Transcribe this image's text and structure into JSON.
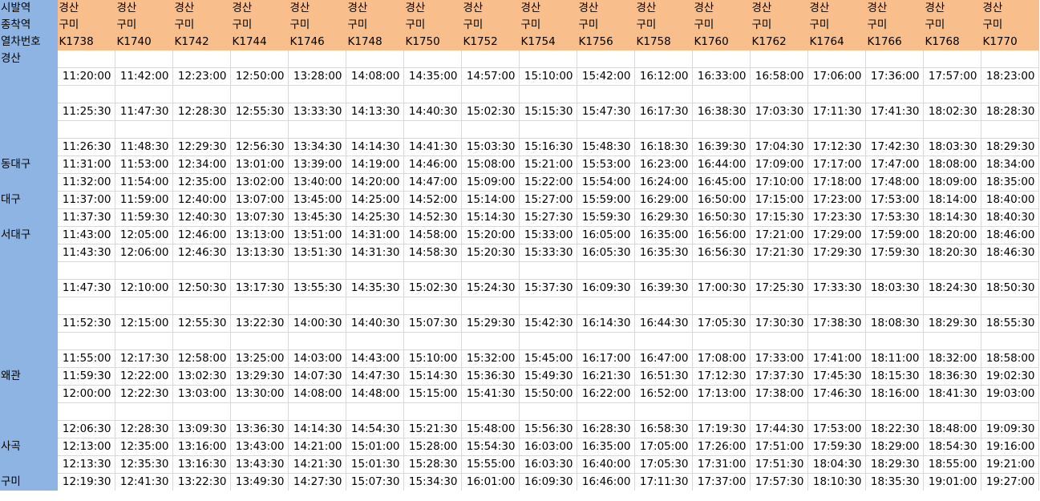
{
  "header": {
    "labels": [
      "시발역",
      "종착역",
      "열차번호"
    ],
    "origin": [
      "경산",
      "경산",
      "경산",
      "경산",
      "경산",
      "경산",
      "경산",
      "경산",
      "경산",
      "경산",
      "경산",
      "경산",
      "경산",
      "경산",
      "경산",
      "경산",
      "경산"
    ],
    "destination": [
      "구미",
      "구미",
      "구미",
      "구미",
      "구미",
      "구미",
      "구미",
      "구미",
      "구미",
      "구미",
      "구미",
      "구미",
      "구미",
      "구미",
      "구미",
      "구미",
      "구미"
    ],
    "trains": [
      "K1738",
      "K1740",
      "K1742",
      "K1744",
      "K1746",
      "K1748",
      "K1750",
      "K1752",
      "K1754",
      "K1756",
      "K1758",
      "K1760",
      "K1762",
      "K1764",
      "K1766",
      "K1768",
      "K1770"
    ]
  },
  "colors": {
    "header_bg": "#f8bf8d",
    "station_bg": "#8db4e2",
    "grid": "#d9d9d9"
  },
  "rows": [
    {
      "station": "경산",
      "times": []
    },
    {
      "station": "",
      "times": [
        "11:20:00",
        "11:42:00",
        "12:23:00",
        "12:50:00",
        "13:28:00",
        "14:08:00",
        "14:35:00",
        "14:57:00",
        "15:10:00",
        "15:42:00",
        "16:12:00",
        "16:33:00",
        "16:58:00",
        "17:06:00",
        "17:36:00",
        "17:57:00",
        "18:23:00"
      ]
    },
    {
      "station": "",
      "times": []
    },
    {
      "station": "",
      "times": [
        "11:25:30",
        "11:47:30",
        "12:28:30",
        "12:55:30",
        "13:33:30",
        "14:13:30",
        "14:40:30",
        "15:02:30",
        "15:15:30",
        "15:47:30",
        "16:17:30",
        "16:38:30",
        "17:03:30",
        "17:11:30",
        "17:41:30",
        "18:02:30",
        "18:28:30"
      ]
    },
    {
      "station": "",
      "times": []
    },
    {
      "station": "",
      "times": [
        "11:26:30",
        "11:48:30",
        "12:29:30",
        "12:56:30",
        "13:34:30",
        "14:14:30",
        "14:41:30",
        "15:03:30",
        "15:16:30",
        "15:48:30",
        "16:18:30",
        "16:39:30",
        "17:04:30",
        "17:12:30",
        "17:42:30",
        "18:03:30",
        "18:29:30"
      ]
    },
    {
      "station": "동대구",
      "times": [
        "11:31:00",
        "11:53:00",
        "12:34:00",
        "13:01:00",
        "13:39:00",
        "14:19:00",
        "14:46:00",
        "15:08:00",
        "15:21:00",
        "15:53:00",
        "16:23:00",
        "16:44:00",
        "17:09:00",
        "17:17:00",
        "17:47:00",
        "18:08:00",
        "18:34:00"
      ]
    },
    {
      "station": "",
      "times": [
        "11:32:00",
        "11:54:00",
        "12:35:00",
        "13:02:00",
        "13:40:00",
        "14:20:00",
        "14:47:00",
        "15:09:00",
        "15:22:00",
        "15:54:00",
        "16:24:00",
        "16:45:00",
        "17:10:00",
        "17:18:00",
        "17:48:00",
        "18:09:00",
        "18:35:00"
      ]
    },
    {
      "station": "대구",
      "times": [
        "11:37:00",
        "11:59:00",
        "12:40:00",
        "13:07:00",
        "13:45:00",
        "14:25:00",
        "14:52:00",
        "15:14:00",
        "15:27:00",
        "15:59:00",
        "16:29:00",
        "16:50:00",
        "17:15:00",
        "17:23:00",
        "17:53:00",
        "18:14:00",
        "18:40:00"
      ]
    },
    {
      "station": "",
      "times": [
        "11:37:30",
        "11:59:30",
        "12:40:30",
        "13:07:30",
        "13:45:30",
        "14:25:30",
        "14:52:30",
        "15:14:30",
        "15:27:30",
        "15:59:30",
        "16:29:30",
        "16:50:30",
        "17:15:30",
        "17:23:30",
        "17:53:30",
        "18:14:30",
        "18:40:30"
      ]
    },
    {
      "station": "서대구",
      "times": [
        "11:43:00",
        "12:05:00",
        "12:46:00",
        "13:13:00",
        "13:51:00",
        "14:31:00",
        "14:58:00",
        "15:20:00",
        "15:33:00",
        "16:05:00",
        "16:35:00",
        "16:56:00",
        "17:21:00",
        "17:29:00",
        "17:59:00",
        "18:20:00",
        "18:46:00"
      ]
    },
    {
      "station": "",
      "times": [
        "11:43:30",
        "12:06:00",
        "12:46:30",
        "13:13:30",
        "13:51:30",
        "14:31:30",
        "14:58:30",
        "15:20:30",
        "15:33:30",
        "16:05:30",
        "16:35:30",
        "16:56:30",
        "17:21:30",
        "17:29:30",
        "17:59:30",
        "18:20:30",
        "18:46:30"
      ]
    },
    {
      "station": "",
      "times": []
    },
    {
      "station": "",
      "times": [
        "11:47:30",
        "12:10:00",
        "12:50:30",
        "13:17:30",
        "13:55:30",
        "14:35:30",
        "15:02:30",
        "15:24:30",
        "15:37:30",
        "16:09:30",
        "16:39:30",
        "17:00:30",
        "17:25:30",
        "17:33:30",
        "18:03:30",
        "18:24:30",
        "18:50:30"
      ]
    },
    {
      "station": "",
      "times": []
    },
    {
      "station": "",
      "times": [
        "11:52:30",
        "12:15:00",
        "12:55:30",
        "13:22:30",
        "14:00:30",
        "14:40:30",
        "15:07:30",
        "15:29:30",
        "15:42:30",
        "16:14:30",
        "16:44:30",
        "17:05:30",
        "17:30:30",
        "17:38:30",
        "18:08:30",
        "18:29:30",
        "18:55:30"
      ]
    },
    {
      "station": "",
      "times": []
    },
    {
      "station": "",
      "times": [
        "11:55:00",
        "12:17:30",
        "12:58:00",
        "13:25:00",
        "14:03:00",
        "14:43:00",
        "15:10:00",
        "15:32:00",
        "15:45:00",
        "16:17:00",
        "16:47:00",
        "17:08:00",
        "17:33:00",
        "17:41:00",
        "18:11:00",
        "18:32:00",
        "18:58:00"
      ]
    },
    {
      "station": "왜관",
      "times": [
        "11:59:30",
        "12:22:00",
        "13:02:30",
        "13:29:30",
        "14:07:30",
        "14:47:30",
        "15:14:30",
        "15:36:30",
        "15:49:30",
        "16:21:30",
        "16:51:30",
        "17:12:30",
        "17:37:30",
        "17:45:30",
        "18:15:30",
        "18:36:30",
        "19:02:30"
      ]
    },
    {
      "station": "",
      "times": [
        "12:00:00",
        "12:22:30",
        "13:03:00",
        "13:30:00",
        "14:08:00",
        "14:48:00",
        "15:15:00",
        "15:41:30",
        "15:50:00",
        "16:22:00",
        "16:52:00",
        "17:13:00",
        "17:38:00",
        "17:46:30",
        "18:16:00",
        "18:41:30",
        "19:03:00"
      ]
    },
    {
      "station": "",
      "times": []
    },
    {
      "station": "",
      "times": [
        "12:06:30",
        "12:28:30",
        "13:09:30",
        "13:36:30",
        "14:14:30",
        "14:54:30",
        "15:21:30",
        "15:48:00",
        "15:56:30",
        "16:28:30",
        "16:58:30",
        "17:19:30",
        "17:44:30",
        "17:53:00",
        "18:22:30",
        "18:48:00",
        "19:09:30"
      ]
    },
    {
      "station": "사곡",
      "times": [
        "12:13:00",
        "12:35:00",
        "13:16:00",
        "13:43:00",
        "14:21:00",
        "15:01:00",
        "15:28:00",
        "15:54:30",
        "16:03:00",
        "16:35:00",
        "17:05:00",
        "17:26:00",
        "17:51:00",
        "17:59:30",
        "18:29:00",
        "18:54:30",
        "19:16:00"
      ]
    },
    {
      "station": "",
      "times": [
        "12:13:30",
        "12:35:30",
        "13:16:30",
        "13:43:30",
        "14:21:30",
        "15:01:30",
        "15:28:30",
        "15:55:00",
        "16:03:30",
        "16:40:00",
        "17:05:30",
        "17:31:00",
        "17:51:30",
        "18:04:30",
        "18:29:30",
        "18:55:00",
        "19:21:00"
      ]
    },
    {
      "station": "구미",
      "times": [
        "12:19:30",
        "12:41:30",
        "13:22:30",
        "13:49:30",
        "14:27:30",
        "15:07:30",
        "15:34:30",
        "16:01:00",
        "16:09:30",
        "16:46:00",
        "17:11:30",
        "17:37:00",
        "17:57:30",
        "18:10:30",
        "18:35:30",
        "19:01:00",
        "19:27:00"
      ]
    }
  ]
}
